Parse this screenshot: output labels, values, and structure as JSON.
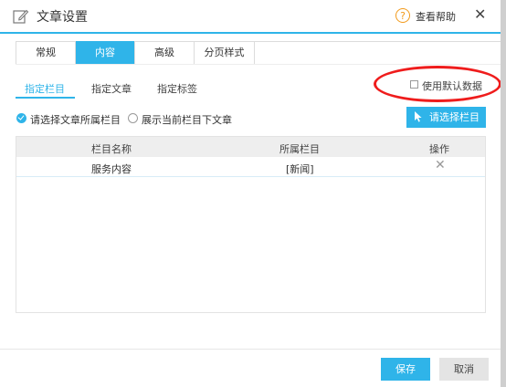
{
  "dialog": {
    "title": "文章设置",
    "help_icon": "?",
    "help_label": "查看帮助",
    "close_label": "✕"
  },
  "tabs": [
    {
      "label": "常规",
      "active": false
    },
    {
      "label": "内容",
      "active": true
    },
    {
      "label": "高级",
      "active": false
    },
    {
      "label": "分页样式",
      "active": false
    }
  ],
  "subtabs": [
    {
      "label": "指定栏目",
      "active": true
    },
    {
      "label": "指定文章",
      "active": false
    },
    {
      "label": "指定标签",
      "active": false
    }
  ],
  "use_default": {
    "label": "使用默认数据",
    "checked": false
  },
  "radio_options": [
    {
      "label": "请选择文章所属栏目",
      "checked": true
    },
    {
      "label": "展示当前栏目下文章",
      "checked": false
    }
  ],
  "select_column_button": "请选择栏目",
  "table": {
    "headers": [
      "栏目名称",
      "所属栏目",
      "操作"
    ],
    "rows": [
      {
        "name": "服务内容",
        "parent": "[新闻]",
        "action": "✕"
      }
    ]
  },
  "footer": {
    "save_label": "保存",
    "cancel_label": "取消"
  },
  "colors": {
    "accent": "#2fb4e9",
    "help": "#f29a1b",
    "annotation": "#ef1c1c"
  },
  "icons": [
    "edit-icon",
    "help-icon",
    "close-icon",
    "cursor-icon",
    "remove-icon"
  ]
}
